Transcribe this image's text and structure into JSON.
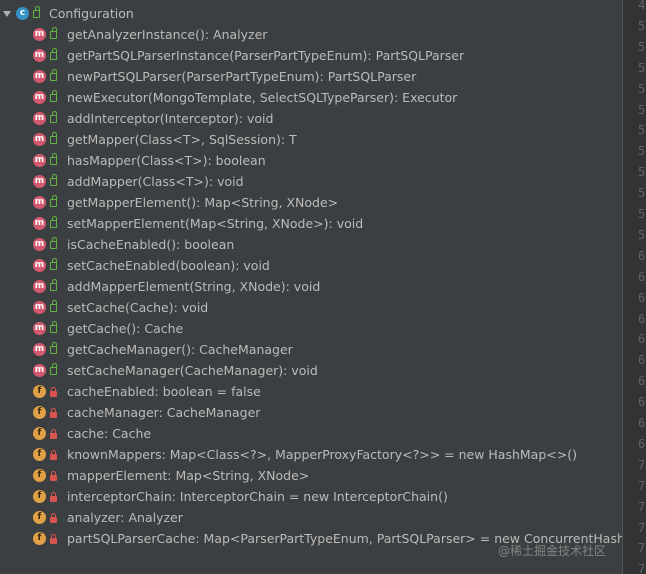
{
  "root": {
    "label": "Configuration",
    "kind": "class",
    "badge": "c",
    "visibility": "public"
  },
  "members": [
    {
      "label": "getAnalyzerInstance(): Analyzer",
      "kind": "method",
      "badge": "m",
      "visibility": "public"
    },
    {
      "label": "getPartSQLParserInstance(ParserPartTypeEnum): PartSQLParser",
      "kind": "method",
      "badge": "m",
      "visibility": "public"
    },
    {
      "label": "newPartSQLParser(ParserPartTypeEnum): PartSQLParser",
      "kind": "method",
      "badge": "m",
      "visibility": "public"
    },
    {
      "label": "newExecutor(MongoTemplate, SelectSQLTypeParser): Executor",
      "kind": "method",
      "badge": "m",
      "visibility": "public"
    },
    {
      "label": "addInterceptor(Interceptor): void",
      "kind": "method",
      "badge": "m",
      "visibility": "public"
    },
    {
      "label": "getMapper(Class<T>, SqlSession): T",
      "kind": "method",
      "badge": "m",
      "visibility": "public"
    },
    {
      "label": "hasMapper(Class<T>): boolean",
      "kind": "method",
      "badge": "m",
      "visibility": "public"
    },
    {
      "label": "addMapper(Class<T>): void",
      "kind": "method",
      "badge": "m",
      "visibility": "public"
    },
    {
      "label": "getMapperElement(): Map<String, XNode>",
      "kind": "method",
      "badge": "m",
      "visibility": "public"
    },
    {
      "label": "setMapperElement(Map<String, XNode>): void",
      "kind": "method",
      "badge": "m",
      "visibility": "public"
    },
    {
      "label": "isCacheEnabled(): boolean",
      "kind": "method",
      "badge": "m",
      "visibility": "public"
    },
    {
      "label": "setCacheEnabled(boolean): void",
      "kind": "method",
      "badge": "m",
      "visibility": "public"
    },
    {
      "label": "addMapperElement(String, XNode): void",
      "kind": "method",
      "badge": "m",
      "visibility": "public"
    },
    {
      "label": "setCache(Cache): void",
      "kind": "method",
      "badge": "m",
      "visibility": "public"
    },
    {
      "label": "getCache(): Cache",
      "kind": "method",
      "badge": "m",
      "visibility": "public"
    },
    {
      "label": "getCacheManager(): CacheManager",
      "kind": "method",
      "badge": "m",
      "visibility": "public"
    },
    {
      "label": "setCacheManager(CacheManager): void",
      "kind": "method",
      "badge": "m",
      "visibility": "public"
    },
    {
      "label": "cacheEnabled: boolean = false",
      "kind": "field",
      "badge": "f",
      "visibility": "private"
    },
    {
      "label": "cacheManager: CacheManager",
      "kind": "field",
      "badge": "f",
      "visibility": "private"
    },
    {
      "label": "cache: Cache",
      "kind": "field",
      "badge": "f",
      "visibility": "private"
    },
    {
      "label": "knownMappers: Map<Class<?>, MapperProxyFactory<?>> = new HashMap<>()",
      "kind": "field",
      "badge": "f",
      "visibility": "private"
    },
    {
      "label": "mapperElement: Map<String, XNode>",
      "kind": "field",
      "badge": "f",
      "visibility": "private"
    },
    {
      "label": "interceptorChain: InterceptorChain = new InterceptorChain()",
      "kind": "field",
      "badge": "f",
      "visibility": "private"
    },
    {
      "label": "analyzer: Analyzer",
      "kind": "field",
      "badge": "f",
      "visibility": "private"
    },
    {
      "label": "partSQLParserCache: Map<ParserPartTypeEnum, PartSQLParser> = new ConcurrentHashMap<>()",
      "kind": "field",
      "badge": "f",
      "visibility": "private"
    }
  ],
  "gutter_numbers": [
    "4",
    "5",
    "5",
    "5",
    "5",
    "5",
    "5",
    "5",
    "5",
    "5",
    "5",
    "5",
    "6",
    "6",
    "6",
    "6",
    "6",
    "6",
    "6",
    "6",
    "6",
    "6",
    "7",
    "7",
    "7",
    "7",
    "7",
    "7"
  ],
  "watermark": "@稀土掘金技术社区",
  "colors": {
    "panel_bg": "#3c3f41",
    "text": "#bbbbbb",
    "class_badge": "#3592c4",
    "method_badge": "#d35a6e",
    "field_badge": "#e0a146",
    "public_lock": "#62b543",
    "private_lock": "#d9534f"
  }
}
